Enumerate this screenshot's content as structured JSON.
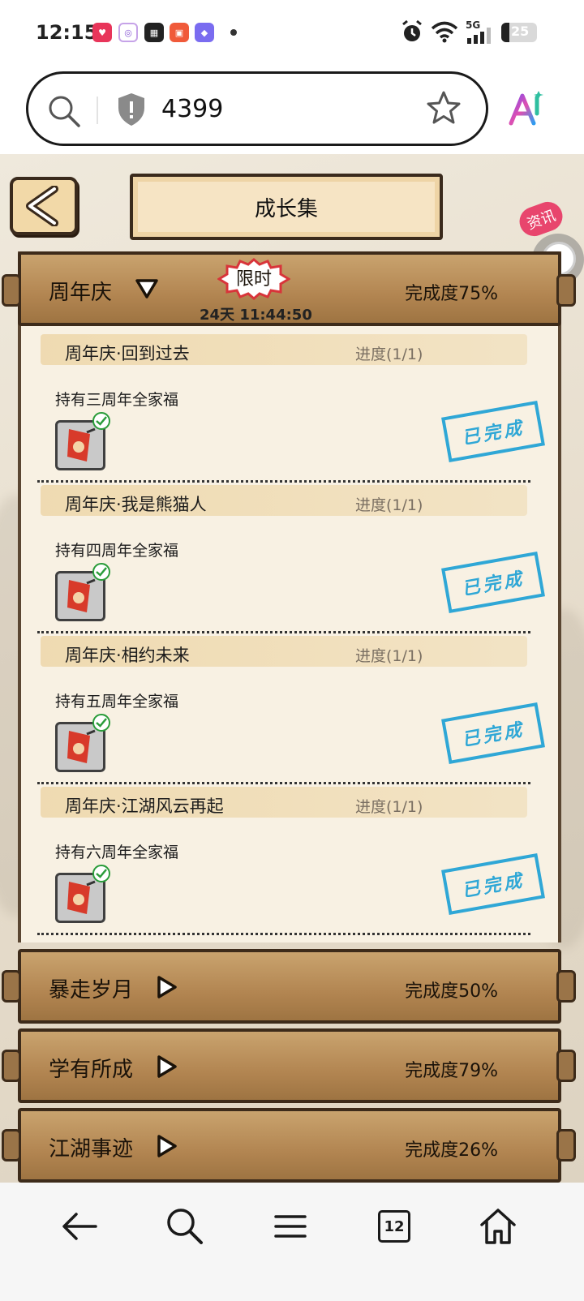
{
  "status_bar": {
    "time": "12:15",
    "battery": "25",
    "network": "5G",
    "notification_icons": [
      "app-icon-1",
      "app-icon-2",
      "app-icon-3",
      "app-icon-4",
      "app-icon-5"
    ],
    "system_icons": [
      "alarm-icon",
      "wifi-icon",
      "signal-icon",
      "battery-icon"
    ]
  },
  "address_bar": {
    "url": "4399"
  },
  "game": {
    "title": "成长集",
    "news_badge": "资讯",
    "limited_label": "限时",
    "countdown": "24天 11:44:50",
    "sections": [
      {
        "name": "周年庆",
        "completion": "完成度75%",
        "expanded": true,
        "tasks": [
          {
            "title": "周年庆·回到过去",
            "progress": "进度(1/1)",
            "desc": "持有三周年全家福",
            "stamp": "已完成"
          },
          {
            "title": "周年庆·我是熊猫人",
            "progress": "进度(1/1)",
            "desc": "持有四周年全家福",
            "stamp": "已完成"
          },
          {
            "title": "周年庆·相约未来",
            "progress": "进度(1/1)",
            "desc": "持有五周年全家福",
            "stamp": "已完成"
          },
          {
            "title": "周年庆·江湖风云再起",
            "progress": "进度(1/1)",
            "desc": "持有六周年全家福",
            "stamp": "已完成"
          }
        ]
      },
      {
        "name": "暴走岁月",
        "completion": "完成度50%",
        "expanded": false
      },
      {
        "name": "学有所成",
        "completion": "完成度79%",
        "expanded": false
      },
      {
        "name": "江湖事迹",
        "completion": "完成度26%",
        "expanded": false
      }
    ]
  },
  "nav_bar": {
    "tab_count": "12",
    "buttons": [
      "back-arrow-icon",
      "search-icon",
      "menu-icon",
      "tabs-icon",
      "home-icon"
    ]
  },
  "colors": {
    "stamp": "#2fa7d6",
    "header_wood": "#b28551",
    "badge": "#e8456d"
  }
}
